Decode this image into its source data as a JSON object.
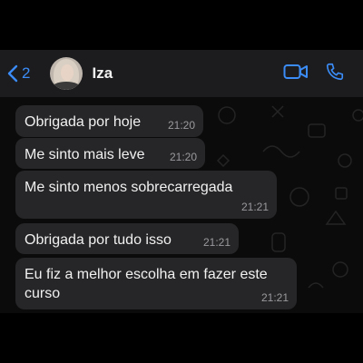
{
  "header": {
    "back_count": "2",
    "contact_name": "Iza",
    "accent": "#3b8cf7"
  },
  "icons": {
    "back": "chevron-left-icon",
    "video": "video-camera-icon",
    "phone": "phone-icon"
  },
  "messages": [
    {
      "text": "Obrigada por hoje",
      "time": "21:20"
    },
    {
      "text": "Me sinto mais leve",
      "time": "21:20"
    },
    {
      "text": "Me sinto menos sobrecarregada",
      "time": "21:21"
    },
    {
      "text": "Obrigada por tudo isso",
      "time": "21:21"
    },
    {
      "text": "Eu fiz a melhor escolha em fazer este curso",
      "time": "21:21"
    }
  ]
}
